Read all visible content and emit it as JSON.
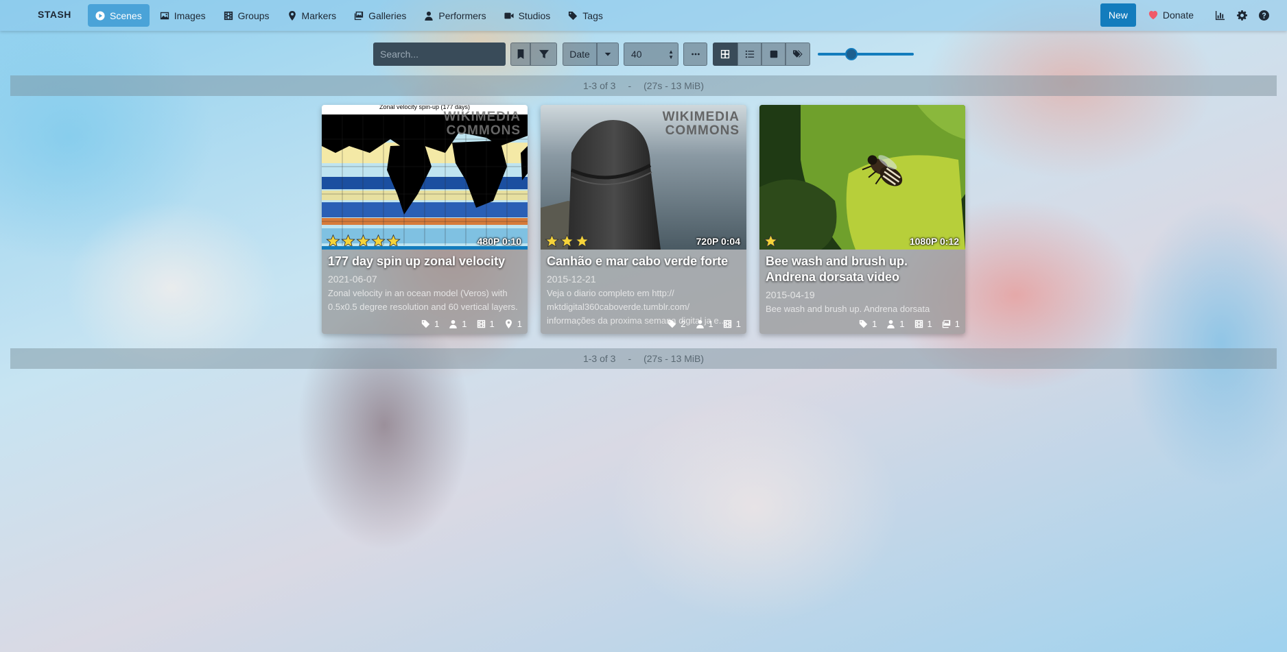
{
  "navbar": {
    "brand": "STASH",
    "items": [
      {
        "label": "Scenes",
        "icon": "play-circle-icon",
        "active": true
      },
      {
        "label": "Images",
        "icon": "image-icon"
      },
      {
        "label": "Groups",
        "icon": "film-icon"
      },
      {
        "label": "Markers",
        "icon": "map-marker-icon"
      },
      {
        "label": "Galleries",
        "icon": "images-icon"
      },
      {
        "label": "Performers",
        "icon": "user-icon"
      },
      {
        "label": "Studios",
        "icon": "video-icon"
      },
      {
        "label": "Tags",
        "icon": "tag-icon"
      }
    ],
    "new_label": "New",
    "donate_label": "Donate"
  },
  "toolbar": {
    "search_placeholder": "Search...",
    "sort_label": "Date",
    "per_page": "40",
    "zoom_level": 0.3
  },
  "pagination": {
    "range": "1-3 of 3",
    "separator": "-",
    "summary": "(27s - 13 MiB)"
  },
  "scenes": [
    {
      "title": "177 day spin up zonal velocity",
      "date": "2021-06-07",
      "description": "Zonal velocity in an ocean model (Veros) with 0.5x0.5 degree resolution and 60 vertical layers.",
      "resolution": "480P 0:10",
      "rating": 5,
      "thumb_caption": "Zonal velocity spin-up (177 days)",
      "watermark_1": "WIKIMEDIA",
      "watermark_2": "COMMONS",
      "counts": {
        "tags": "1",
        "performers": "1",
        "groups": "1",
        "markers": "1"
      }
    },
    {
      "title": "Canhão e mar cabo verde forte",
      "date": "2015-12-21",
      "description": "Veja o diario completo em http:// mktdigital360caboverde.tumblr.com/ informações da proxima semana digital ja e...",
      "resolution": "720P 0:04",
      "rating": 3,
      "watermark_1": "WIKIMEDIA",
      "watermark_2": "COMMONS",
      "counts": {
        "tags": "2",
        "performers": "1",
        "groups": "1"
      }
    },
    {
      "title": "Bee wash and brush up. Andrena dorsata video",
      "date": "2015-04-19",
      "description": "Bee wash and brush up. Andrena dorsata",
      "resolution": "1080P 0:12",
      "rating": 1,
      "counts": {
        "tags": "1",
        "performers": "1",
        "groups": "1",
        "galleries": "1"
      }
    }
  ],
  "colors": {
    "accent": "#137cbd",
    "active_nav": "#4aa3d8",
    "star": "#f5d33a"
  }
}
